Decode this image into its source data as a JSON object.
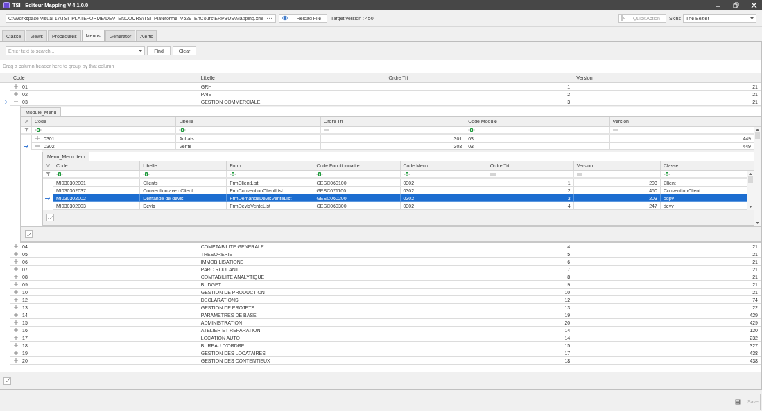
{
  "window": {
    "title": "TSI - Editeur Mapping V-4.1.0.0"
  },
  "toolbar": {
    "file_path": "C:\\Workspace Visual 17\\TSI_PLATEFORME\\DEV_ENCOURS\\TSI_Plateforme_V529_EnCours\\ERPBUS\\Mapping.xml",
    "reload_button": "Reload File",
    "target_version": "Target version : 450",
    "quick_action": {
      "placeholder": "Quick Action"
    },
    "skins_label": "Skins",
    "skin": "The Bezier"
  },
  "tabs": [
    {
      "label": "Classe",
      "selected": false
    },
    {
      "label": "Views",
      "selected": false
    },
    {
      "label": "Procedures",
      "selected": false
    },
    {
      "label": "Menus",
      "selected": true
    },
    {
      "label": "Generator",
      "selected": false
    },
    {
      "label": "Alerts",
      "selected": false
    }
  ],
  "search": {
    "placeholder": "Enter text to search...",
    "find_button": "Find",
    "clear_button": "Clear"
  },
  "group_panel": "Drag a column header here to group by that column",
  "grid": {
    "columns": [
      {
        "label": "Code",
        "kind": "text"
      },
      {
        "label": "Libelle",
        "kind": "text"
      },
      {
        "label": "Ordre Tri",
        "kind": "number"
      },
      {
        "label": "Version",
        "kind": "number"
      }
    ],
    "rows": [
      {
        "cells": [
          "01",
          "GRH",
          "1",
          "21"
        ],
        "expanded": false,
        "current": false
      },
      {
        "cells": [
          "02",
          "PAIE",
          "2",
          "21"
        ],
        "expanded": false,
        "current": false
      },
      {
        "cells": [
          "03",
          "GESTION COMMERCIALE",
          "3",
          "21"
        ],
        "expanded": true,
        "current": true,
        "detail": {
          "tab": "Module_Menu",
          "filter_row": true,
          "columns": [
            {
              "label": "Code",
              "kind": "text"
            },
            {
              "label": "Libelle",
              "kind": "text"
            },
            {
              "label": "Ordre Tri",
              "kind": "number"
            },
            {
              "label": "Code Module",
              "kind": "text"
            },
            {
              "label": "Version",
              "kind": "number"
            }
          ],
          "rows": [
            {
              "cells": [
                "0301",
                "Achats",
                "301",
                "03",
                "449"
              ],
              "expanded": false,
              "current": false
            },
            {
              "cells": [
                "0302",
                "Vente",
                "303",
                "03",
                "449"
              ],
              "expanded": true,
              "current": true,
              "detail": {
                "tab": "Menu_Menu Item",
                "filter_row": true,
                "columns": [
                  {
                    "label": "Code",
                    "kind": "text"
                  },
                  {
                    "label": "Libelle",
                    "kind": "text"
                  },
                  {
                    "label": "Form",
                    "kind": "text"
                  },
                  {
                    "label": "Code Fonctionnalite",
                    "kind": "text"
                  },
                  {
                    "label": "Code Menu",
                    "kind": "text"
                  },
                  {
                    "label": "Ordre Tri",
                    "kind": "number"
                  },
                  {
                    "label": "Version",
                    "kind": "number"
                  },
                  {
                    "label": "Classe",
                    "kind": "text"
                  }
                ],
                "rows": [
                  {
                    "cells": [
                      "MI030302001",
                      "Clients",
                      "FrmClientList",
                      "GESC060100",
                      "0302",
                      "1",
                      "203",
                      "Client"
                    ],
                    "current": false,
                    "selected": false
                  },
                  {
                    "cells": [
                      "MI030302037",
                      "Convention avec Client",
                      "FrmConventionClientList",
                      "GESC071100",
                      "0302",
                      "2",
                      "450",
                      "ConventionClient"
                    ],
                    "current": false,
                    "selected": false
                  },
                  {
                    "cells": [
                      "MI030302002",
                      "Demande de devis",
                      "FrmDemandeDevisVenteList",
                      "GESC060200",
                      "0302",
                      "3",
                      "203",
                      "ddpv"
                    ],
                    "current": true,
                    "selected": true
                  },
                  {
                    "cells": [
                      "MI030302003",
                      "Devis",
                      "FrmDevisVenteList",
                      "GESC060300",
                      "0302",
                      "4",
                      "247",
                      "devv"
                    ],
                    "current": false,
                    "selected": false
                  }
                ]
              }
            }
          ]
        }
      },
      {
        "cells": [
          "04",
          "COMPTABILITE GENERALE",
          "4",
          "21"
        ],
        "expanded": false,
        "current": false
      },
      {
        "cells": [
          "05",
          "TRESORERIE",
          "5",
          "21"
        ],
        "expanded": false,
        "current": false
      },
      {
        "cells": [
          "06",
          "IMMOBILISATIONS",
          "6",
          "21"
        ],
        "expanded": false,
        "current": false
      },
      {
        "cells": [
          "07",
          "PARC ROULANT",
          "7",
          "21"
        ],
        "expanded": false,
        "current": false
      },
      {
        "cells": [
          "08",
          "COMTABILITE ANALYTIQUE",
          "8",
          "21"
        ],
        "expanded": false,
        "current": false
      },
      {
        "cells": [
          "09",
          "BUDGET",
          "9",
          "21"
        ],
        "expanded": false,
        "current": false
      },
      {
        "cells": [
          "10",
          "GESTION DE PRODUCTION",
          "10",
          "21"
        ],
        "expanded": false,
        "current": false
      },
      {
        "cells": [
          "12",
          "DECLARATIONS",
          "12",
          "74"
        ],
        "expanded": false,
        "current": false
      },
      {
        "cells": [
          "13",
          "GESTION DE PROJETS",
          "13",
          "22"
        ],
        "expanded": false,
        "current": false
      },
      {
        "cells": [
          "14",
          "PARAMETRES DE BASE",
          "19",
          "429"
        ],
        "expanded": false,
        "current": false
      },
      {
        "cells": [
          "15",
          "ADMINISTRATION",
          "20",
          "429"
        ],
        "expanded": false,
        "current": false
      },
      {
        "cells": [
          "16",
          "ATELIER ET REPARATION",
          "14",
          "120"
        ],
        "expanded": false,
        "current": false
      },
      {
        "cells": [
          "17",
          "LOCATION AUTO",
          "14",
          "232"
        ],
        "expanded": false,
        "current": false
      },
      {
        "cells": [
          "18",
          "BUREAU D'ORDRE",
          "15",
          "327"
        ],
        "expanded": false,
        "current": false
      },
      {
        "cells": [
          "19",
          "GESTION DES LOCATAIRES",
          "17",
          "438"
        ],
        "expanded": false,
        "current": false
      },
      {
        "cells": [
          "20",
          "GESTION DES CONTENTIEUX",
          "18",
          "438"
        ],
        "expanded": false,
        "current": false
      }
    ]
  },
  "save_button": {
    "label": "Save",
    "disabled": true
  }
}
